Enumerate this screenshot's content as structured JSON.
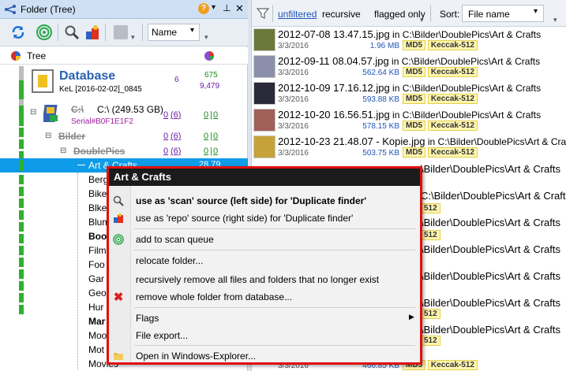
{
  "left_panel": {
    "title": "Folder (Tree)",
    "title_buttons": [
      "?",
      "▾",
      "⌂",
      "×"
    ],
    "toolbar": {
      "sort_label": "Name"
    },
    "tree_header": "Tree",
    "database": {
      "label": "Database",
      "sub": "KeL [2016-02-02]_0845",
      "count": "6",
      "n1": "675",
      "n2": "9,479"
    },
    "drive": {
      "name": "C:\\",
      "label": "C:\\   (249.53 GB)",
      "serial": "Serial#B0F1E1F2",
      "a": "0",
      "b": "(6)",
      "c": "0",
      "d": "0"
    },
    "bilder": {
      "label": "Bilder",
      "a": "0",
      "b": "(6)",
      "c": "0",
      "d": "0"
    },
    "doublepics": {
      "label": "DoublePics",
      "a": "0",
      "b": "(6)",
      "c": "0",
      "d": "0"
    },
    "art": {
      "label": "Art & Crafts",
      "num": "28.79"
    },
    "items": [
      "Berg",
      "Bike",
      "Blke",
      "Blum",
      "Boo",
      "Film",
      "Foo",
      "Gar",
      "Geo",
      "Hur",
      "Mar",
      "Moo",
      "Mot",
      "Movies"
    ]
  },
  "right_panel": {
    "filter": {
      "unfiltered": "unfiltered",
      "recursive": "recursive",
      "flagged": "flagged only"
    },
    "sort": {
      "label": "Sort:",
      "value": "File name"
    },
    "files": [
      {
        "name": "2012-07-08 13.47.15.jpg",
        "in": " in ",
        "path": "C:\\Bilder\\DoublePics\\Art & Crafts",
        "date": "3/3/2016",
        "size": "1.96 MB",
        "md5": "MD5",
        "keccak": "Keccak-512",
        "color": "#6b7a3a"
      },
      {
        "name": "2012-09-11 08.04.57.jpg",
        "in": " in ",
        "path": "C:\\Bilder\\DoublePics\\Art & Crafts",
        "date": "3/3/2016",
        "size": "562.64 KB",
        "md5": "MD5",
        "keccak": "Keccak-512",
        "color": "#8b8faa"
      },
      {
        "name": "2012-10-09 17.16.12.jpg",
        "in": " in ",
        "path": "C:\\Bilder\\DoublePics\\Art & Crafts",
        "date": "3/3/2016",
        "size": "593.88 KB",
        "md5": "MD5",
        "keccak": "Keccak-512",
        "color": "#2a2a3a"
      },
      {
        "name": "2012-10-20 16.56.51.jpg",
        "in": " in ",
        "path": "C:\\Bilder\\DoublePics\\Art & Crafts",
        "date": "3/3/2016",
        "size": "578.15 KB",
        "md5": "MD5",
        "keccak": "Keccak-512",
        "color": "#a0605a"
      },
      {
        "name": "2012-10-23 21.48.07 - Kopie.jpg",
        "in": " in ",
        "path": "C:\\Bilder\\DoublePics\\Art & Crafts",
        "date": "3/3/2016",
        "size": "503.75 KB",
        "md5": "MD5",
        "keccak": "Keccak-512",
        "color": "#c6a23a"
      }
    ],
    "partial": [
      {
        "text": "\\Bilder\\DoublePics\\Art & Crafts"
      },
      {
        "text": "C:\\Bilder\\DoublePics\\Art & Crafts"
      },
      {
        "text": "\\Bilder\\DoublePics\\Art & Crafts"
      },
      {
        "text": "\\Bilder\\DoublePics\\Art & Crafts"
      },
      {
        "text": "\\Bilder\\DoublePics\\Art & Crafts"
      },
      {
        "text": "\\Bilder\\DoublePics\\Art & Crafts"
      },
      {
        "text": "\\Bilder\\DoublePics\\Art & Crafts"
      }
    ],
    "bottom": {
      "date": "3/3/2016",
      "size": "466.85 KB",
      "md5": "MD5",
      "keccak": "Keccak-512"
    },
    "partial_tags": [
      "512",
      "512",
      "512",
      "512"
    ]
  },
  "menu": {
    "title": "Art & Crafts",
    "items": {
      "scan": "use as 'scan' source (left side) for 'Duplicate finder'",
      "repo": "use as 'repo' source (right side) for 'Duplicate finder'",
      "queue": "add to scan queue",
      "relocate": "relocate folder...",
      "remove_missing": "recursively remove all files and folders that no longer exist",
      "remove_folder": "remove whole folder from database...",
      "flags": "Flags",
      "export": "File export...",
      "explorer": "Open in Windows-Explorer..."
    }
  },
  "colors": {
    "accent": "#1e8fe0",
    "highlight": "#0e9be8",
    "menu_border": "#e01010"
  }
}
